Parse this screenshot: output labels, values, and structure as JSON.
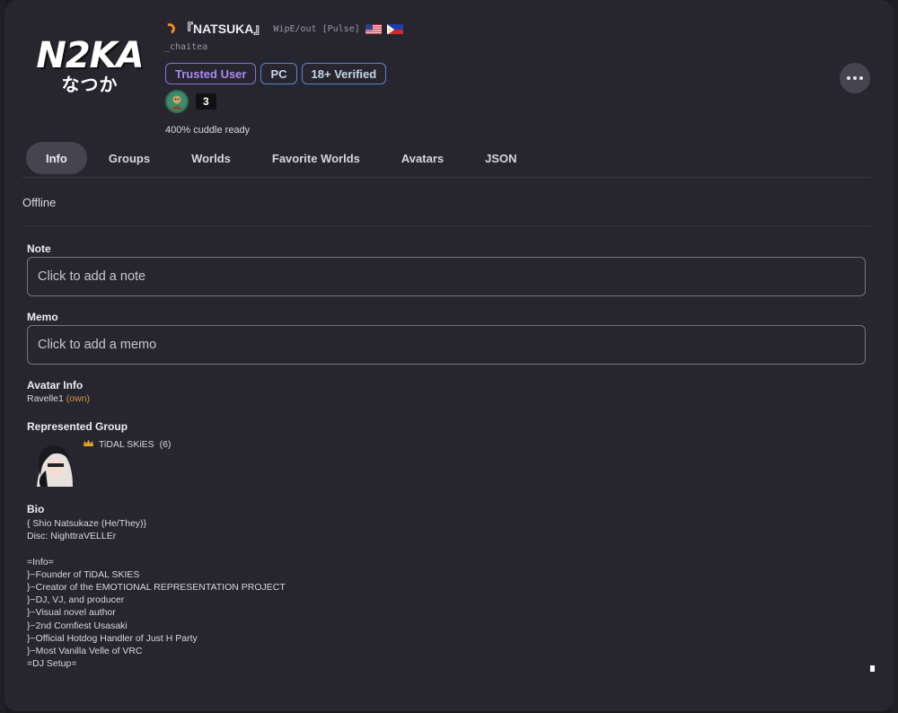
{
  "header": {
    "logo_main": "N2KA",
    "logo_sub": "なつか",
    "display_name": "『NATSUKA』",
    "platform_tag": "WipE/out [Pulse]",
    "username": "_chaitea",
    "status_color": "#f08a24",
    "flags": [
      "us-flag",
      "ph-flag"
    ],
    "badges": [
      "Trusted User",
      "PC",
      "18+ Verified"
    ],
    "mutual_count": "3",
    "status_description": "400% cuddle ready"
  },
  "more_button_icon": "ellipsis-icon",
  "tabs": [
    {
      "label": "Info",
      "active": true
    },
    {
      "label": "Groups",
      "active": false
    },
    {
      "label": "Worlds",
      "active": false
    },
    {
      "label": "Favorite Worlds",
      "active": false
    },
    {
      "label": "Avatars",
      "active": false
    },
    {
      "label": "JSON",
      "active": false
    }
  ],
  "presence": "Offline",
  "note": {
    "label": "Note",
    "placeholder": "Click to add a note"
  },
  "memo": {
    "label": "Memo",
    "placeholder": "Click to add a memo"
  },
  "avatar_info": {
    "label": "Avatar Info",
    "avatar_name": "Ravelle1",
    "own_tag": "(own)"
  },
  "represented_group": {
    "label": "Represented Group",
    "name": "TiDAL SKiES",
    "member_count": "(6)",
    "icon": "crown-icon"
  },
  "bio": {
    "label": "Bio",
    "text": "{ Shio Natsukaze (He/They)}\nDisc: NighttraVELLEr\n\n=Info=\n}~Founder of TiDAL SKIES\n}~Creator of the EMOTIONAL REPRESENTATION PROJECT\n}~DJ, VJ, and producer\n}~Visual novel author\n}~2nd Comfiest Usasaki\n}~Official Hotdog Handler of Just H Party\n}~Most Vanilla Velle of VRC\n=DJ Setup="
  }
}
